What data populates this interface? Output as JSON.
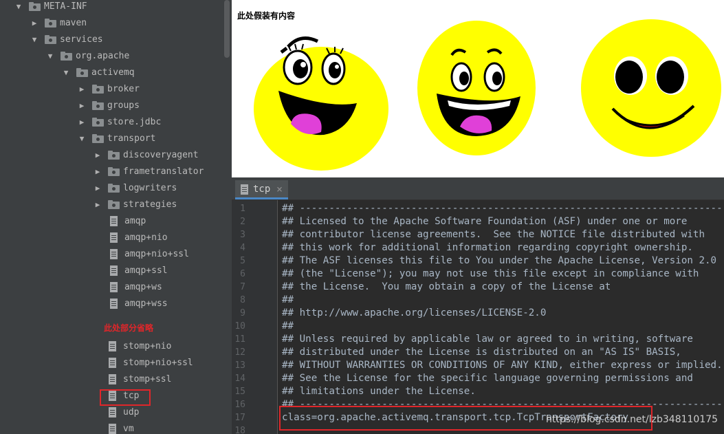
{
  "tree": {
    "items": [
      {
        "label": "META-INF",
        "kind": "folder",
        "expanded": true
      },
      {
        "label": "maven",
        "kind": "folder",
        "expanded": false
      },
      {
        "label": "services",
        "kind": "folder",
        "expanded": true
      },
      {
        "label": "org.apache",
        "kind": "folder",
        "expanded": true
      },
      {
        "label": "activemq",
        "kind": "folder",
        "expanded": true
      },
      {
        "label": "broker",
        "kind": "folder",
        "expanded": false
      },
      {
        "label": "groups",
        "kind": "folder",
        "expanded": false
      },
      {
        "label": "store.jdbc",
        "kind": "folder",
        "expanded": false
      },
      {
        "label": "transport",
        "kind": "folder",
        "expanded": true
      },
      {
        "label": "discoveryagent",
        "kind": "folder",
        "expanded": false
      },
      {
        "label": "frametranslator",
        "kind": "folder",
        "expanded": false
      },
      {
        "label": "logwriters",
        "kind": "folder",
        "expanded": false
      },
      {
        "label": "strategies",
        "kind": "folder",
        "expanded": false
      },
      {
        "label": "amqp",
        "kind": "file"
      },
      {
        "label": "amqp+nio",
        "kind": "file"
      },
      {
        "label": "amqp+nio+ssl",
        "kind": "file"
      },
      {
        "label": "amqp+ssl",
        "kind": "file"
      },
      {
        "label": "amqp+ws",
        "kind": "file"
      },
      {
        "label": "amqp+wss",
        "kind": "file"
      },
      {
        "label": "stomp+nio",
        "kind": "file"
      },
      {
        "label": "stomp+nio+ssl",
        "kind": "file"
      },
      {
        "label": "stomp+ssl",
        "kind": "file"
      },
      {
        "label": "tcp",
        "kind": "file",
        "highlighted": true
      },
      {
        "label": "udp",
        "kind": "file"
      },
      {
        "label": "vm",
        "kind": "file"
      }
    ],
    "omitted_note": "此处部分省略"
  },
  "picture": {
    "caption": "此处假装有内容",
    "faces": [
      "smiley-face-winking",
      "smiley-face-laughing",
      "smiley-face-simple"
    ]
  },
  "editor": {
    "tab_label": "tcp",
    "close_glyph": "×",
    "lines": [
      "## ---------------------------------------------------------------------------",
      "## Licensed to the Apache Software Foundation (ASF) under one or more",
      "## contributor license agreements.  See the NOTICE file distributed with",
      "## this work for additional information regarding copyright ownership.",
      "## The ASF licenses this file to You under the Apache License, Version 2.0",
      "## (the \"License\"); you may not use this file except in compliance with",
      "## the License.  You may obtain a copy of the License at",
      "##",
      "## http://www.apache.org/licenses/LICENSE-2.0",
      "##",
      "## Unless required by applicable law or agreed to in writing, software",
      "## distributed under the License is distributed on an \"AS IS\" BASIS,",
      "## WITHOUT WARRANTIES OR CONDITIONS OF ANY KIND, either express or implied.",
      "## See the License for the specific language governing permissions and",
      "## limitations under the License.",
      "## ---------------------------------------------------------------------------",
      "class=org.apache.activemq.transport.tcp.TcpTransportFactory",
      ""
    ],
    "line_numbers": [
      "1",
      "2",
      "3",
      "4",
      "5",
      "6",
      "7",
      "8",
      "9",
      "10",
      "11",
      "12",
      "13",
      "14",
      "15",
      "16",
      "17",
      "18"
    ]
  },
  "watermark": "https://blog.csdn.net/lzb348110175",
  "colors": {
    "highlight_red": "#e0262a",
    "face_yellow": "#ffff00",
    "tongue_pink": "#e040d8",
    "smile_red": "#ee1111"
  }
}
